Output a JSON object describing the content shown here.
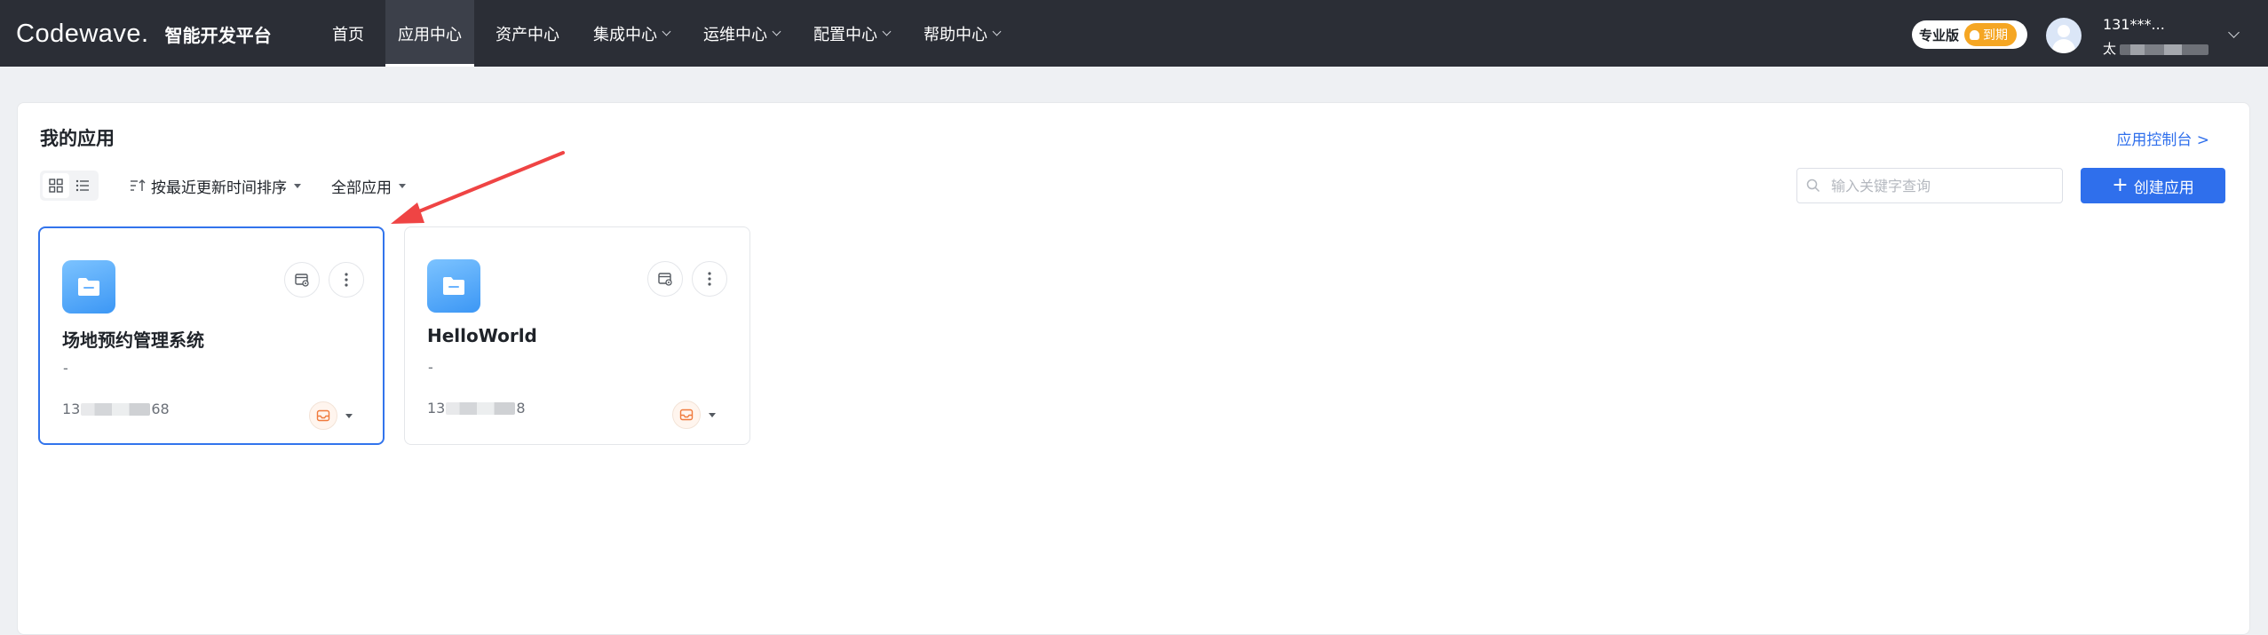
{
  "brand": {
    "logo": "Codewave.",
    "subtitle": "智能开发平台"
  },
  "nav": [
    {
      "label": "首页",
      "dropdown": false,
      "active": false
    },
    {
      "label": "应用中心",
      "dropdown": false,
      "active": true
    },
    {
      "label": "资产中心",
      "dropdown": false,
      "active": false
    },
    {
      "label": "集成中心",
      "dropdown": true,
      "active": false
    },
    {
      "label": "运维中心",
      "dropdown": true,
      "active": false
    },
    {
      "label": "配置中心",
      "dropdown": true,
      "active": false
    },
    {
      "label": "帮助中心",
      "dropdown": true,
      "active": false
    }
  ],
  "account": {
    "edition": "专业版",
    "expire_label": "到期",
    "user_name": "131***...",
    "org_prefix": "太"
  },
  "page": {
    "title": "我的应用",
    "console_link": "应用控制台 >",
    "sort_label": "按最近更新时间排序",
    "filter_label": "全部应用",
    "search_placeholder": "输入关键字查询",
    "create_button": "创建应用"
  },
  "apps": [
    {
      "name": "场地预约管理系统",
      "description": "-",
      "owner_prefix": "13",
      "owner_suffix": "68",
      "selected": true
    },
    {
      "name": "HelloWorld",
      "description": "-",
      "owner_prefix": "13",
      "owner_suffix": "8",
      "selected": false
    }
  ],
  "colors": {
    "topbar": "#2b2e36",
    "primary": "#2f6fec",
    "expire_badge": "#f5a623",
    "annotation_arrow": "#ef4444",
    "status_icon": "#f07a3c"
  }
}
